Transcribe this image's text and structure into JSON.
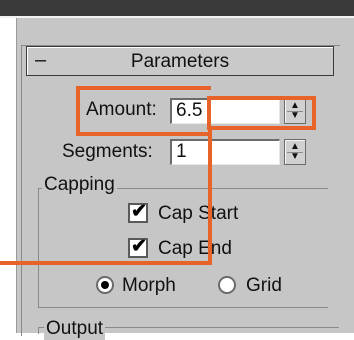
{
  "rollout": {
    "toggle_symbol": "–",
    "title": "Parameters"
  },
  "amount": {
    "label": "Amount:",
    "value": "6.5"
  },
  "segments": {
    "label": "Segments:",
    "value": "1"
  },
  "capping": {
    "group_label": "Capping",
    "cap_start": {
      "label": "Cap Start",
      "checked": true
    },
    "cap_end": {
      "label": "Cap End",
      "checked": true
    },
    "morph": {
      "label": "Morph",
      "selected": true
    },
    "grid": {
      "label": "Grid",
      "selected": false
    }
  },
  "output": {
    "group_label": "Output"
  },
  "icons": {
    "check": "✔",
    "spinner_up": "▲",
    "spinner_down": "▼"
  },
  "colors": {
    "highlight": "#e8632a",
    "panel_bg": "#c6c6c6"
  }
}
